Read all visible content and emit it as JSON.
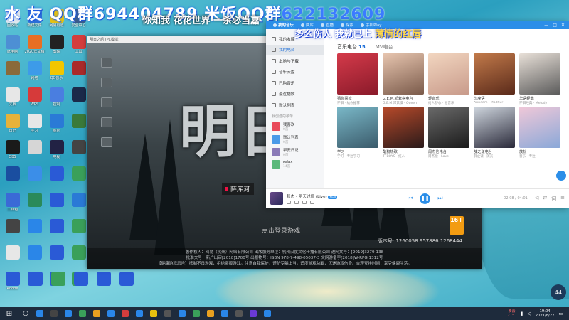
{
  "overlay": {
    "headline_a": "水 友 QQ群",
    "headline_b": "694404789",
    "headline_c": "米饭QQ群",
    "headline_d": "622132609",
    "subline": "你知我 花花世界 一杀必当嘉",
    "subline2_a": "多么伤人 我就已上",
    "subline2_b": "薄情的红唇"
  },
  "desktop_icons": [
    {
      "label": "回收站",
      "color": "#dfe6ee"
    },
    {
      "label": "新建文件",
      "color": "#2c6fd6"
    },
    {
      "label": "网易有道",
      "color": "#e8c10f"
    },
    {
      "label": "安全中心",
      "color": "#3b5b88"
    },
    {
      "label": "此电脑",
      "color": "#4d8fd4"
    },
    {
      "label": "2020年文档",
      "color": "#e86f24"
    },
    {
      "label": "剪映",
      "color": "#222222"
    },
    {
      "label": "工具",
      "color": "#d43d3d"
    },
    {
      "label": "",
      "color": "#8a6a3a"
    },
    {
      "label": "网络",
      "color": "#3d9be9"
    },
    {
      "label": "QQ音乐",
      "color": "#f3c600"
    },
    {
      "label": "",
      "color": "#aa2a2a"
    },
    {
      "label": "文档",
      "color": "#e7e7e7"
    },
    {
      "label": "WPS",
      "color": "#d63a3a"
    },
    {
      "label": "控制",
      "color": "#4a7ee0"
    },
    {
      "label": "",
      "color": "#1b2a4a"
    },
    {
      "label": "日记",
      "color": "#e6b23a"
    },
    {
      "label": "学习",
      "color": "#e7e7e7"
    },
    {
      "label": "图片",
      "color": "#2a7ad6"
    },
    {
      "label": "",
      "color": "#3a7a3a"
    },
    {
      "label": "OBS",
      "color": "#1a1a1a"
    },
    {
      "label": "",
      "color": "#d6d6d6"
    },
    {
      "label": "电视",
      "color": "#222244"
    },
    {
      "label": "",
      "color": "#444444"
    },
    {
      "label": "",
      "color": "#1a4ea0"
    },
    {
      "label": "",
      "color": "#3b8ee8"
    },
    {
      "label": "",
      "color": "#2a5ad6"
    },
    {
      "label": "",
      "color": "#3aa05a"
    },
    {
      "label": "工具箱",
      "color": "#3a6ad6"
    },
    {
      "label": "",
      "color": "#2a8a5a"
    },
    {
      "label": "",
      "color": "#2a5ad6"
    },
    {
      "label": "",
      "color": "#2a7ad6"
    },
    {
      "label": "",
      "color": "#444444"
    },
    {
      "label": "",
      "color": "#2a86e8"
    },
    {
      "label": "",
      "color": "#2a5ad6"
    },
    {
      "label": "",
      "color": "#3aa05a"
    },
    {
      "label": "",
      "color": "#e7e7e7"
    },
    {
      "label": "",
      "color": "#2a86e8"
    },
    {
      "label": "",
      "color": "#2a5ad6"
    },
    {
      "label": "",
      "color": "#3aa05a"
    },
    {
      "label": "Adobe",
      "color": "#b11"
    },
    {
      "label": "",
      "color": "#2a5ad6"
    },
    {
      "label": "",
      "color": "#2a5ad6"
    },
    {
      "label": "",
      "color": "#3aa05a"
    }
  ],
  "bottom_icons": [
    {
      "label": "",
      "color": "#2a5ad6"
    },
    {
      "label": "",
      "color": "#2a5ad6"
    },
    {
      "label": "",
      "color": "#3aa05a"
    },
    {
      "label": "",
      "color": "#2a5ad6"
    },
    {
      "label": "",
      "color": "#2a5ad6"
    },
    {
      "label": "",
      "color": "#2a5ad6"
    }
  ],
  "game": {
    "window_title": "明日之后 (PC模拟)",
    "big_title": "明日",
    "location": "萨库河",
    "enter_label": "点击登录游戏",
    "version": "版本号: 1260058.957886.1268444",
    "age": "16+",
    "legal_1": "著作权人：网易（杭州）网络有限公司    出版服务单位：杭州汉度文化传播有限公司    进网文号：[2019]3279-138",
    "legal_2": "批准文号：新广出审[2018]1700号    出版物号：ISBN 978-7-498-05037-3    文网游备字[2018]W-RPG 1312号",
    "legal_3": "【健康游戏忠告】抵制不良游戏，拒绝盗版游戏。注意自我保护，谨防受骗上当。适度游戏益脑，沉迷游戏伤身。合理安排时间，享受健康生活。"
  },
  "music": {
    "tabs": [
      {
        "label": "我的音乐",
        "active": true
      },
      {
        "label": "曲库",
        "active": false
      },
      {
        "label": "直播",
        "active": false
      },
      {
        "label": "探索",
        "active": false
      },
      {
        "label": "手机Play",
        "active": false
      }
    ],
    "nav": [
      {
        "label": "我的收藏",
        "active": false
      },
      {
        "label": "我的电台",
        "active": true
      },
      {
        "label": "本地与下载",
        "active": false
      },
      {
        "label": "音乐云盘",
        "active": false
      },
      {
        "label": "已购音乐",
        "active": false
      },
      {
        "label": "最近播放",
        "active": false
      },
      {
        "label": "默认列表",
        "active": false
      }
    ],
    "section_label": "我创建的歌单",
    "playlists": [
      {
        "name": "我喜欢",
        "count": "0首",
        "color": "#e94a5a"
      },
      {
        "name": "默认列表",
        "count": "0首",
        "color": "#4a9ae8"
      },
      {
        "name": "早安日记",
        "count": "0首",
        "color": "#8a7ab8"
      },
      {
        "name": "relax",
        "count": "14首",
        "color": "#5ab87a"
      }
    ],
    "category_label": "音乐电台",
    "category_count": "15",
    "mv_label": "MV电台",
    "cards": [
      {
        "title": "猜你喜欢",
        "sub": "怀旧 · 给你推荐",
        "c1": "#d43a4a",
        "c2": "#8a1a2a"
      },
      {
        "title": "G.E.M.邓紫棋电台",
        "sub": "G.E.M.邓紫棋 · Queen",
        "c1": "#e8c6b0",
        "c2": "#7a5a4a"
      },
      {
        "title": "轻音乐",
        "sub": "给人舒心 · 轻音乐",
        "c1": "#f2d6c0",
        "c2": "#c89a8a"
      },
      {
        "title": "印度语",
        "sub": "Arindam · Madhur",
        "c1": "#c27a4a",
        "c2": "#5a2a1a"
      },
      {
        "title": "华语经典",
        "sub": "怀旧经典 · Melody",
        "c1": "#e8e0d8",
        "c2": "#5a5a5a"
      },
      {
        "title": "学习",
        "sub": "学习 · 专注学习",
        "c1": "#7ab8c8",
        "c2": "#3a5a6a"
      },
      {
        "title": "酷狗热歌",
        "sub": "TFBOYS · 红人",
        "c1": "#b84a2a",
        "c2": "#2a1a1a"
      },
      {
        "title": "周杰伦电台",
        "sub": "周杰伦 · Love",
        "c1": "#6a6a6a",
        "c2": "#1a1a1a"
      },
      {
        "title": "薛之谦电台",
        "sub": "薛之谦 · 演员",
        "c1": "#cfd6de",
        "c2": "#2a2a3a"
      },
      {
        "title": "放松",
        "sub": "音乐 · 专注",
        "c1": "#f0c8d8",
        "c2": "#8aa8d8"
      }
    ],
    "player": {
      "title": "张杰 - 明天过后 (Live)",
      "badge": "标准",
      "time": "02:08 / 04:01"
    }
  },
  "taskbar": {
    "icons": [
      "#2a86e8",
      "#444",
      "#2a86e8",
      "#3aa05a",
      "#e8a020",
      "#2a86e8",
      "#d43d3d",
      "#2a86e8",
      "#e8c10f",
      "#555",
      "#2a86e8",
      "#3aa05a",
      "#e8a020",
      "#2a86e8",
      "#555",
      "#6a3ad6",
      "#2a86e8"
    ],
    "tray_note_1": "多云",
    "tray_note_2": "21℃",
    "time": "19:04",
    "date": "2021/8/27"
  },
  "widget": {
    "value": "44"
  }
}
